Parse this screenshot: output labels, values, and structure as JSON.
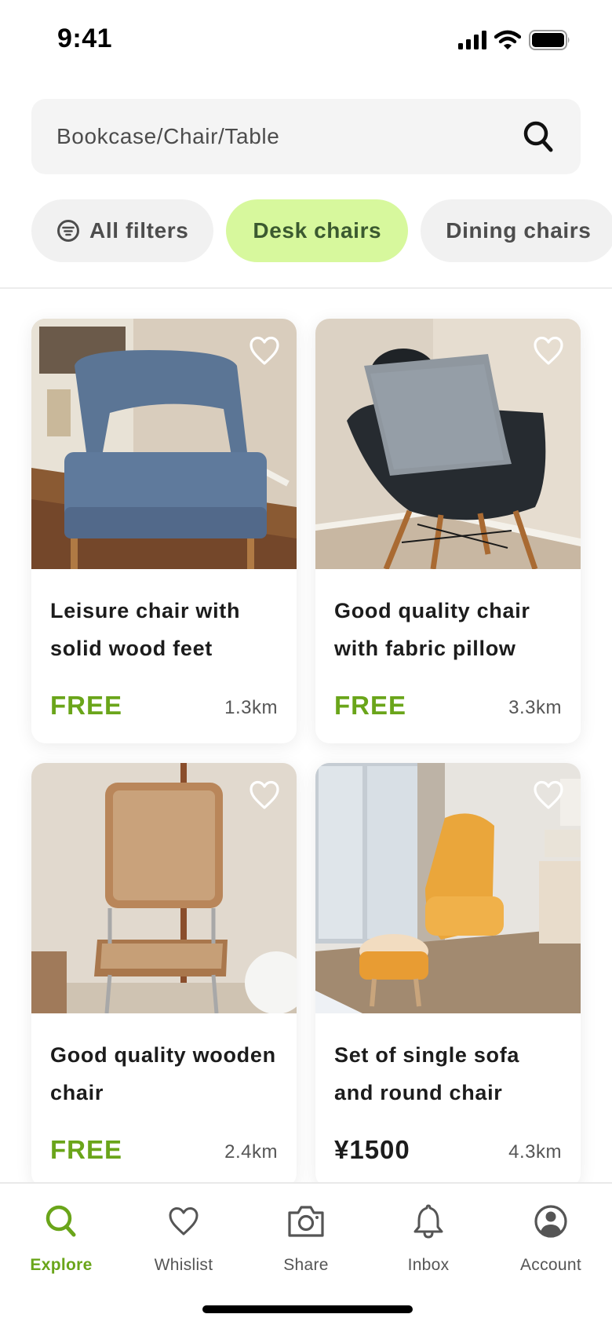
{
  "status_bar": {
    "time": "9:41"
  },
  "search": {
    "placeholder": "Bookcase/Chair/Table",
    "icon": "search-icon"
  },
  "filters": [
    {
      "label": "All filters",
      "icon": "filter-icon",
      "active": false
    },
    {
      "label": "Desk chairs",
      "active": true
    },
    {
      "label": "Dining chairs",
      "active": false
    }
  ],
  "listings": [
    {
      "title": "Leisure chair with solid wood feet",
      "price": "FREE",
      "distance": "1.3km",
      "image": "blue upholstered chair with wooden legs",
      "favorited": false
    },
    {
      "title": "Good quality chair with fabric pillow",
      "price": "FREE",
      "distance": "3.3km",
      "image": "black shell chair with grey cushion",
      "favorited": false
    },
    {
      "title": "Good quality wooden chair",
      "price": "FREE",
      "distance": "2.4km",
      "image": "wooden rattan cantilever chair",
      "favorited": false
    },
    {
      "title": "Set of single sofa and round chair",
      "price": "¥1500",
      "distance": "4.3km",
      "image": "yellow armchair and round stool",
      "favorited": false
    }
  ],
  "bottom_nav": [
    {
      "label": "Explore",
      "icon": "search-icon",
      "active": true
    },
    {
      "label": "Whislist",
      "icon": "heart-icon",
      "active": false
    },
    {
      "label": "Share",
      "icon": "camera-icon",
      "active": false
    },
    {
      "label": "Inbox",
      "icon": "bell-icon",
      "active": false
    },
    {
      "label": "Account",
      "icon": "account-icon",
      "active": false
    }
  ],
  "colors": {
    "accent": "#6aa51a",
    "chip_active_bg": "#d7f89d",
    "chip_active_text": "#3b5a30"
  }
}
